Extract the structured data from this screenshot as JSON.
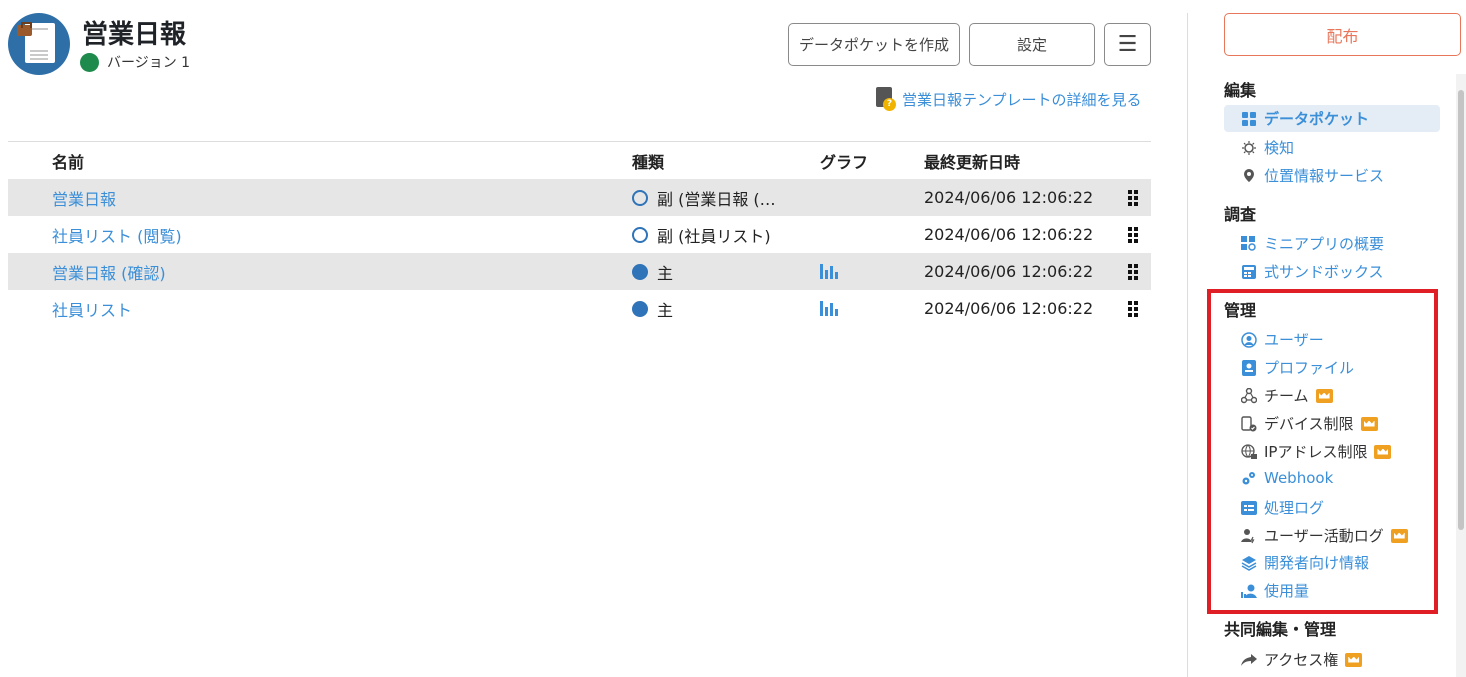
{
  "app": {
    "title": "営業日報",
    "version": "バージョン 1"
  },
  "toolbar": {
    "create_label": "データポケットを作成",
    "settings_label": "設定",
    "menu_label": "☰"
  },
  "template_link": "営業日報テンプレートの詳細を見る",
  "table": {
    "headers": {
      "name": "名前",
      "type": "種類",
      "graph": "グラフ",
      "updated": "最終更新日時"
    },
    "rows": [
      {
        "name": "営業日報",
        "type": "副 (営業日報 (…",
        "type_kind": "sub",
        "graph": false,
        "updated": "2024/06/06 12:06:22"
      },
      {
        "name": "社員リスト (閲覧)",
        "type": "副 (社員リスト)",
        "type_kind": "sub",
        "graph": false,
        "updated": "2024/06/06 12:06:22"
      },
      {
        "name": "営業日報 (確認)",
        "type": "主",
        "type_kind": "main",
        "graph": true,
        "updated": "2024/06/06 12:06:22"
      },
      {
        "name": "社員リスト",
        "type": "主",
        "type_kind": "main",
        "graph": true,
        "updated": "2024/06/06 12:06:22"
      }
    ]
  },
  "sidebar": {
    "deploy_label": "配布",
    "sections": {
      "edit": "編集",
      "investigate": "調査",
      "manage": "管理",
      "collab": "共同編集・管理"
    },
    "items": {
      "datapocket": "データポケット",
      "detect": "検知",
      "location": "位置情報サービス",
      "miniapp": "ミニアプリの概要",
      "sandbox": "式サンドボックス",
      "users": "ユーザー",
      "profile": "プロファイル",
      "team": "チーム",
      "device": "デバイス制限",
      "ip": "IPアドレス制限",
      "webhook": "Webhook",
      "log": "処理ログ",
      "activity": "ユーザー活動ログ",
      "dev": "開発者向け情報",
      "usage": "使用量",
      "access": "アクセス権"
    }
  },
  "colors": {
    "accent": "#3b8fd8",
    "deploy": "#e8765a",
    "highlight": "#e01e26",
    "version_dot": "#1e8a4c",
    "premium": "#f0a020"
  }
}
